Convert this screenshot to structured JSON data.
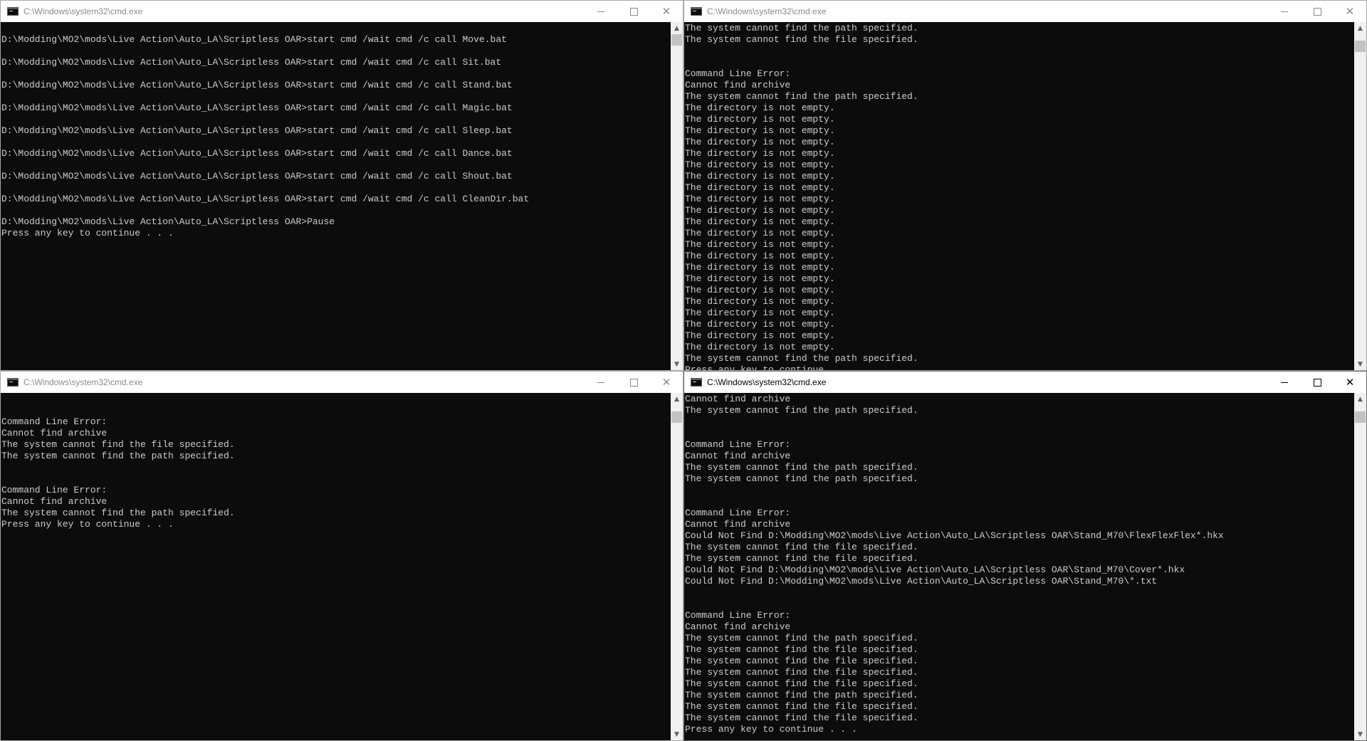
{
  "windows": {
    "top_left": {
      "title": "C:\\Windows\\system32\\cmd.exe",
      "lines": [
        "",
        "D:\\Modding\\MO2\\mods\\Live Action\\Auto_LA\\Scriptless OAR>start cmd /wait cmd /c call Move.bat",
        "",
        "D:\\Modding\\MO2\\mods\\Live Action\\Auto_LA\\Scriptless OAR>start cmd /wait cmd /c call Sit.bat",
        "",
        "D:\\Modding\\MO2\\mods\\Live Action\\Auto_LA\\Scriptless OAR>start cmd /wait cmd /c call Stand.bat",
        "",
        "D:\\Modding\\MO2\\mods\\Live Action\\Auto_LA\\Scriptless OAR>start cmd /wait cmd /c call Magic.bat",
        "",
        "D:\\Modding\\MO2\\mods\\Live Action\\Auto_LA\\Scriptless OAR>start cmd /wait cmd /c call Sleep.bat",
        "",
        "D:\\Modding\\MO2\\mods\\Live Action\\Auto_LA\\Scriptless OAR>start cmd /wait cmd /c call Dance.bat",
        "",
        "D:\\Modding\\MO2\\mods\\Live Action\\Auto_LA\\Scriptless OAR>start cmd /wait cmd /c call Shout.bat",
        "",
        "D:\\Modding\\MO2\\mods\\Live Action\\Auto_LA\\Scriptless OAR>start cmd /wait cmd /c call CleanDir.bat",
        "",
        "D:\\Modding\\MO2\\mods\\Live Action\\Auto_LA\\Scriptless OAR>Pause",
        "Press any key to continue . . ."
      ],
      "scroll_position": 0.0
    },
    "top_right": {
      "title": "C:\\Windows\\system32\\cmd.exe",
      "lines": [
        "The system cannot find the path specified.",
        "The system cannot find the file specified.",
        "",
        "",
        "Command Line Error:",
        "Cannot find archive",
        "The system cannot find the path specified.",
        "The directory is not empty.",
        "The directory is not empty.",
        "The directory is not empty.",
        "The directory is not empty.",
        "The directory is not empty.",
        "The directory is not empty.",
        "The directory is not empty.",
        "The directory is not empty.",
        "The directory is not empty.",
        "The directory is not empty.",
        "The directory is not empty.",
        "The directory is not empty.",
        "The directory is not empty.",
        "The directory is not empty.",
        "The directory is not empty.",
        "The directory is not empty.",
        "The directory is not empty.",
        "The directory is not empty.",
        "The directory is not empty.",
        "The directory is not empty.",
        "The directory is not empty.",
        "The directory is not empty.",
        "The system cannot find the path specified.",
        "Press any key to continue . . ."
      ],
      "scroll_position": 0.02
    },
    "bottom_left": {
      "title": "C:\\Windows\\system32\\cmd.exe",
      "lines": [
        "",
        "",
        "Command Line Error:",
        "Cannot find archive",
        "The system cannot find the file specified.",
        "The system cannot find the path specified.",
        "",
        "",
        "Command Line Error:",
        "Cannot find archive",
        "The system cannot find the path specified.",
        "Press any key to continue . . ."
      ],
      "scroll_position": 0.02
    },
    "bottom_right": {
      "title": "C:\\Windows\\system32\\cmd.exe",
      "lines": [
        "Cannot find archive",
        "The system cannot find the path specified.",
        "",
        "",
        "Command Line Error:",
        "Cannot find archive",
        "The system cannot find the path specified.",
        "The system cannot find the path specified.",
        "",
        "",
        "Command Line Error:",
        "Cannot find archive",
        "Could Not Find D:\\Modding\\MO2\\mods\\Live Action\\Auto_LA\\Scriptless OAR\\Stand_M70\\FlexFlexFlex*.hkx",
        "The system cannot find the file specified.",
        "The system cannot find the file specified.",
        "Could Not Find D:\\Modding\\MO2\\mods\\Live Action\\Auto_LA\\Scriptless OAR\\Stand_M70\\Cover*.hkx",
        "Could Not Find D:\\Modding\\MO2\\mods\\Live Action\\Auto_LA\\Scriptless OAR\\Stand_M70\\*.txt",
        "",
        "",
        "Command Line Error:",
        "Cannot find archive",
        "The system cannot find the path specified.",
        "The system cannot find the file specified.",
        "The system cannot find the file specified.",
        "The system cannot find the file specified.",
        "The system cannot find the file specified.",
        "The system cannot find the path specified.",
        "The system cannot find the file specified.",
        "The system cannot find the file specified.",
        "Press any key to continue . . ."
      ],
      "scroll_position": 0.02
    }
  },
  "icons": {
    "app": "cmd-icon",
    "minimize": "minimize-icon",
    "maximize": "maximize-icon",
    "close": "close-icon",
    "scroll_up": "scroll-up-arrow-icon",
    "scroll_down": "scroll-down-arrow-icon"
  },
  "colors": {
    "console_bg": "#0c0c0c",
    "console_text": "#cccccc",
    "titlebar_bg": "#ffffff"
  }
}
